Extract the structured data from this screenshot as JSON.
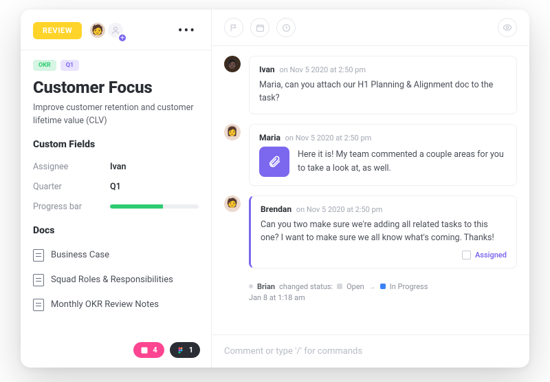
{
  "header": {
    "status_label": "REVIEW"
  },
  "tags": {
    "okr": "OKR",
    "q1": "Q1"
  },
  "title": "Customer Focus",
  "description": "Improve customer retention and customer lifetime value (CLV)",
  "custom_fields": {
    "heading": "Custom Fields",
    "assignee": {
      "label": "Assignee",
      "value": "Ivan"
    },
    "quarter": {
      "label": "Quarter",
      "value": "Q1"
    },
    "progress": {
      "label": "Progress bar",
      "percent": 60
    }
  },
  "docs": {
    "heading": "Docs",
    "items": [
      "Business Case",
      "Squad Roles & Responsibilities",
      "Monthly OKR Review Notes"
    ]
  },
  "footer": {
    "pink_count": "4",
    "dark_count": "1"
  },
  "activity": {
    "messages": [
      {
        "author": "Ivan",
        "timestamp": "on Nov 5 2020 at 2:50 pm",
        "body": "Maria, can you attach our H1 Planning & Alignment doc to the task?"
      },
      {
        "author": "Maria",
        "timestamp": "on Nov 5 2020 at 2:50 pm",
        "body": "Here it is! My team commented a couple areas for you to take a look at, as well."
      },
      {
        "author": "Brendan",
        "timestamp": "on Nov 5 2020 at 2:50 pm",
        "body": "Can you two make sure we're adding all related tasks to this one? I want to make sure we all know what's coming. Thanks!",
        "assigned_label": "Assigned"
      }
    ],
    "status_change": {
      "actor": "Brian",
      "verb": "changed status:",
      "from": "Open",
      "to": "In Progress",
      "timestamp": "Jan 8 at 1:18 am"
    }
  },
  "comment_placeholder": "Comment or type '/' for commands"
}
